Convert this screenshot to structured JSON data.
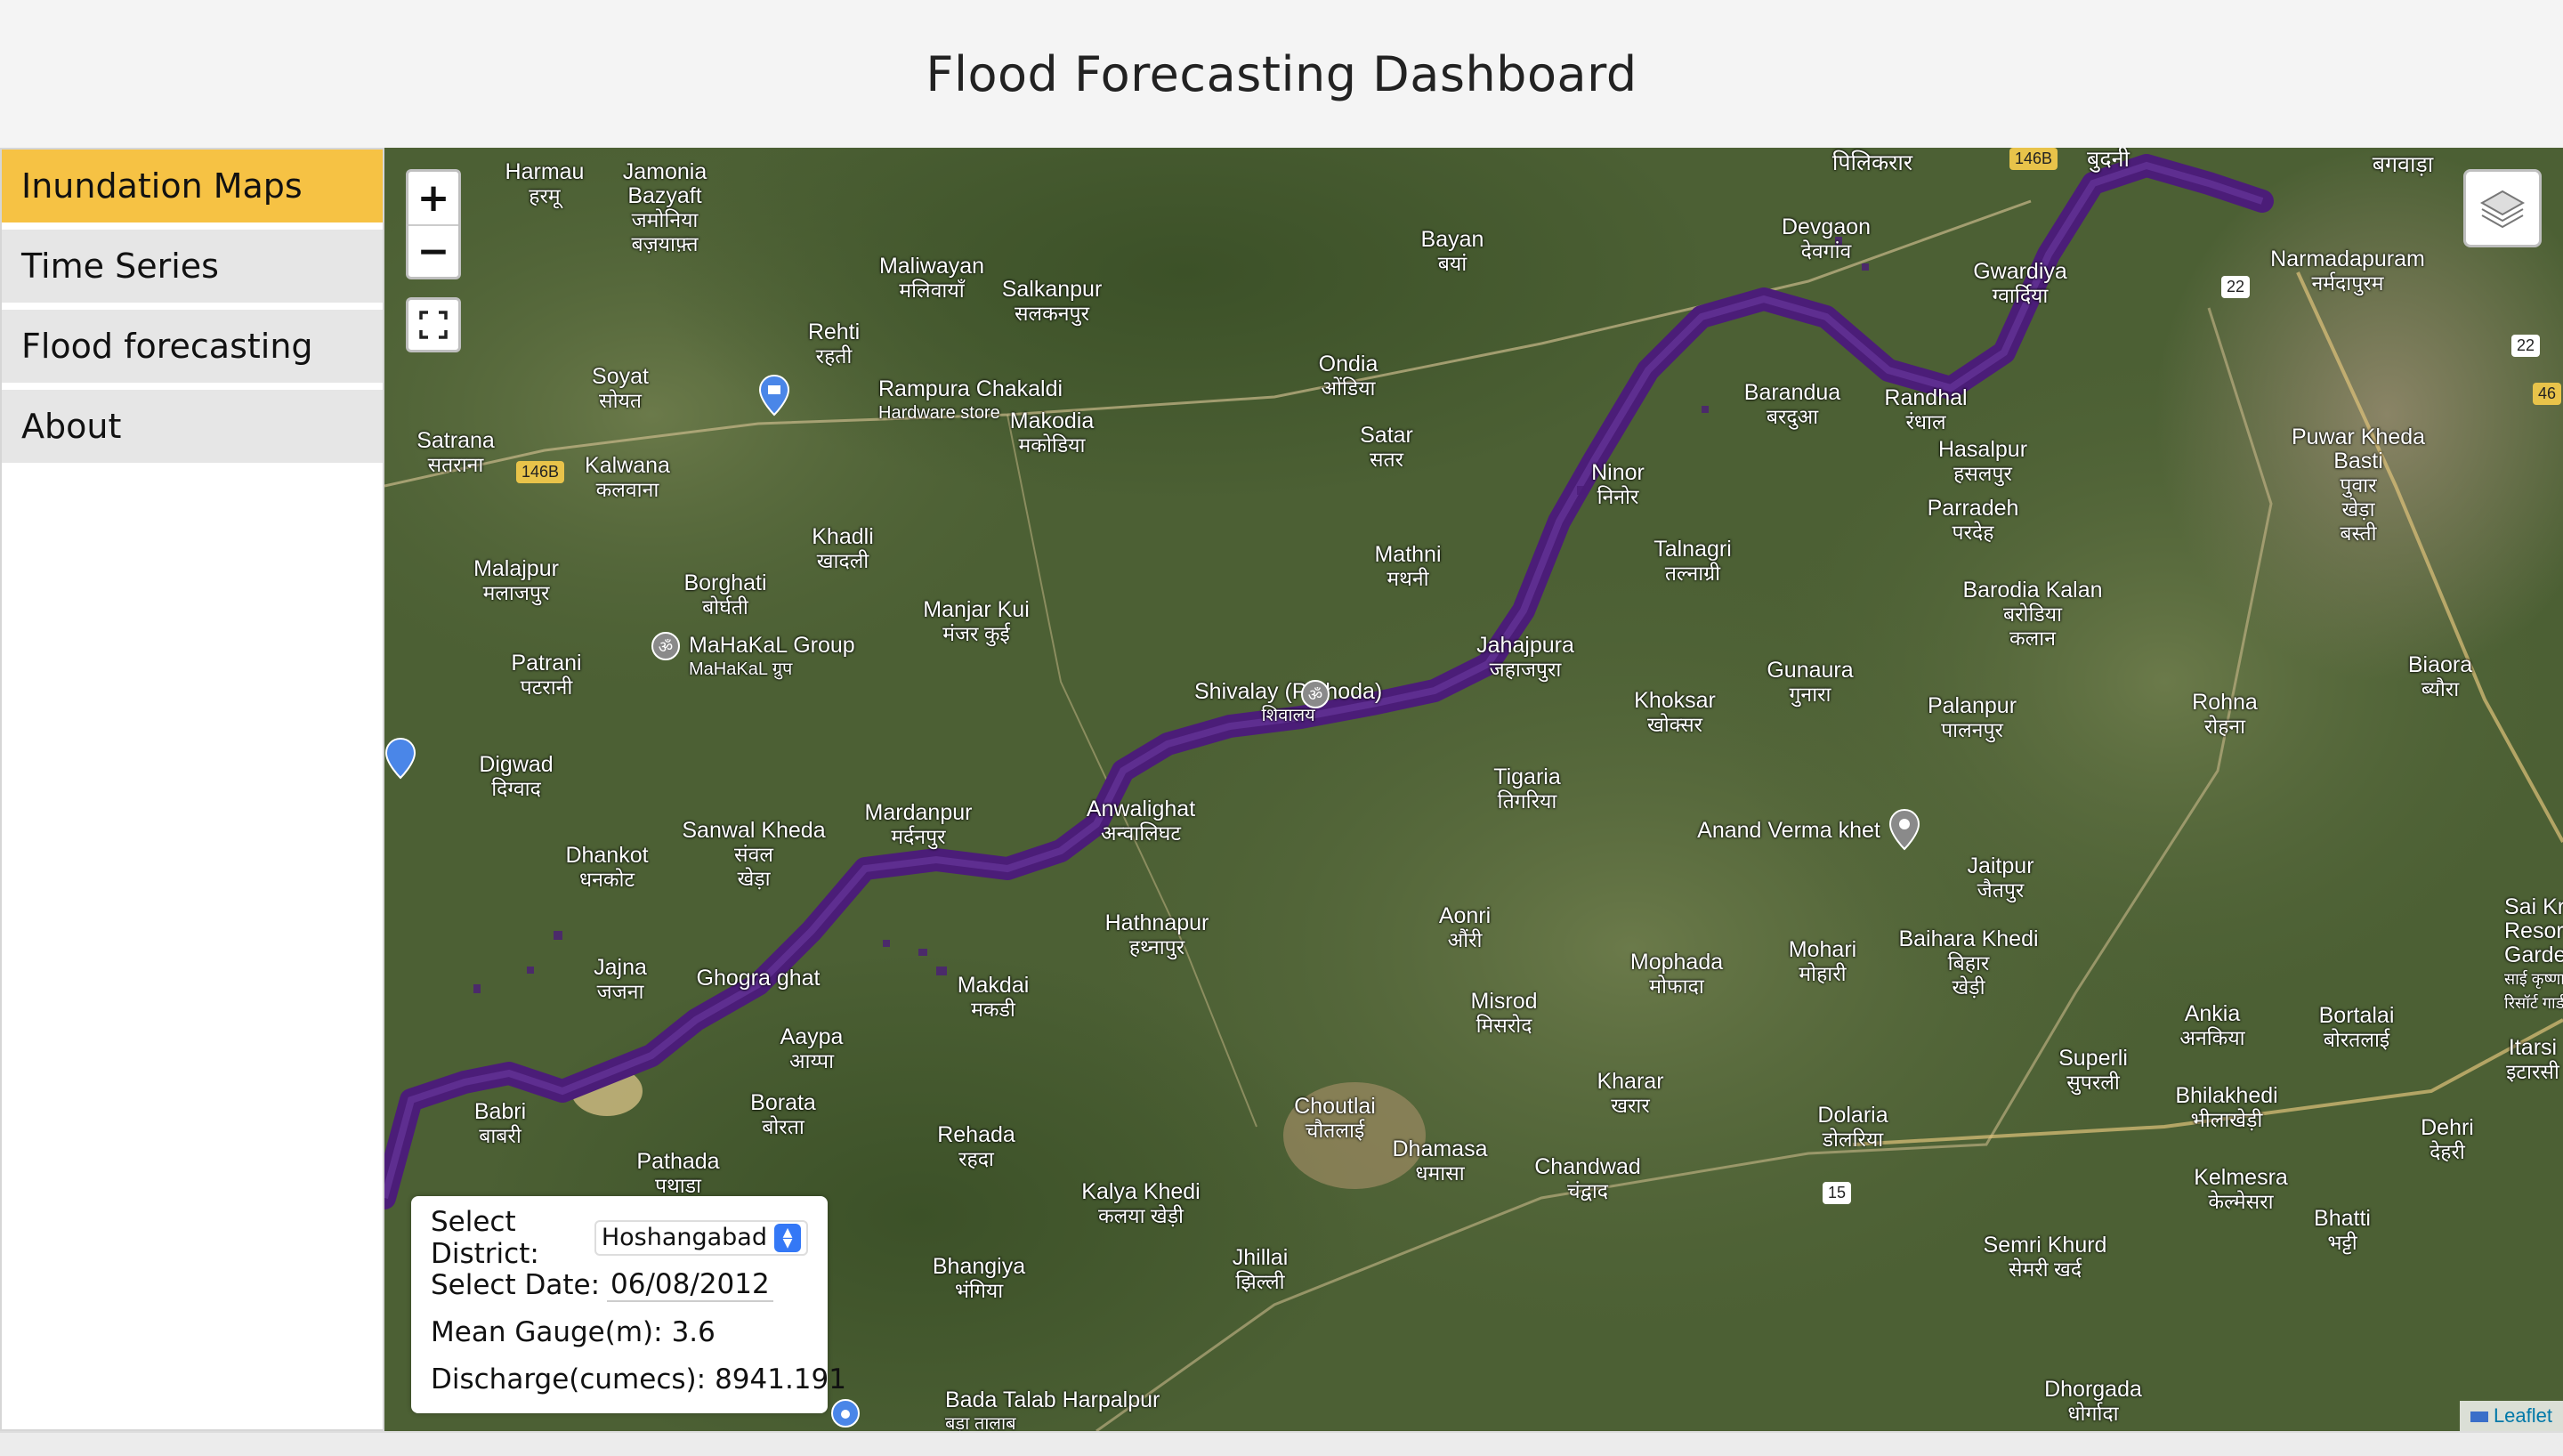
{
  "header": {
    "title": "Flood Forecasting Dashboard"
  },
  "sidebar": {
    "items": [
      {
        "label": "Inundation Maps",
        "active": true
      },
      {
        "label": "Time Series",
        "active": false
      },
      {
        "label": "Flood forecasting",
        "active": false
      },
      {
        "label": "About",
        "active": false
      }
    ]
  },
  "map": {
    "zoom_in": "+",
    "zoom_out": "−",
    "attribution": "Leaflet",
    "colors": {
      "flood": "#4b1d78",
      "land": "#4a5e33",
      "accent": "#f6c244"
    },
    "places": [
      {
        "name": "Harmau",
        "hindi": "हरमू"
      },
      {
        "name": "Jamonia Bazyaft",
        "hindi": "जमोनिया बज़याफ़्त"
      },
      {
        "name": "Maliwayan",
        "hindi": "मलिवायाँ"
      },
      {
        "name": "Salkanpur",
        "hindi": "सलकनपुर"
      },
      {
        "name": "Rehti",
        "hindi": "रहती"
      },
      {
        "name": "Soyat",
        "hindi": "सोयत"
      },
      {
        "name": "Rampura Chakaldi",
        "hindi": "Hardware store"
      },
      {
        "name": "Makodia",
        "hindi": "मकोडिया"
      },
      {
        "name": "Satrana",
        "hindi": "सतराना"
      },
      {
        "name": "Kalwana",
        "hindi": "कलवाना"
      },
      {
        "name": "Khadli",
        "hindi": "खादली"
      },
      {
        "name": "Malajpur",
        "hindi": "मलाजपुर"
      },
      {
        "name": "Borghati",
        "hindi": "बोर्घती"
      },
      {
        "name": "MaHaKaL Group",
        "hindi": "MaHaKaL ग्रुप"
      },
      {
        "name": "Manjar Kui",
        "hindi": "मंजर कुई"
      },
      {
        "name": "Patrani",
        "hindi": "पटरानी"
      },
      {
        "name": "Digwad",
        "hindi": "दिग्वाद"
      },
      {
        "name": "Dhankot",
        "hindi": "धनकोट"
      },
      {
        "name": "Sanwal Kheda",
        "hindi": "संवल खेड़ा"
      },
      {
        "name": "Mardanpur",
        "hindi": "मर्दनपुर"
      },
      {
        "name": "Anwalighat",
        "hindi": "अन्वालिघट"
      },
      {
        "name": "Jajna",
        "hindi": "जजना"
      },
      {
        "name": "Ghogra ghat",
        "hindi": ""
      },
      {
        "name": "Makdai",
        "hindi": "मकडी"
      },
      {
        "name": "Aaypa",
        "hindi": "आय्पा"
      },
      {
        "name": "Hathnapur",
        "hindi": "हथ्नापुर"
      },
      {
        "name": "Babri",
        "hindi": "बाबरी"
      },
      {
        "name": "Borata",
        "hindi": "बोरता"
      },
      {
        "name": "Pathada",
        "hindi": "पथाडा"
      },
      {
        "name": "Rehada",
        "hindi": "रहदा"
      },
      {
        "name": "Kalya Khedi",
        "hindi": "कलया खेड़ी"
      },
      {
        "name": "Bhangiya",
        "hindi": "भंगिया"
      },
      {
        "name": "Jhillai",
        "hindi": "झिल्ली"
      },
      {
        "name": "Choutlai",
        "hindi": "चौतलाई"
      },
      {
        "name": "Dhamasa",
        "hindi": "धमासा"
      },
      {
        "name": "Chandwad",
        "hindi": "चंद्वाद"
      },
      {
        "name": "Bada Talab Harpalpur",
        "hindi": "बड़ा तालाब"
      },
      {
        "name": "Shivalay (Pathoda)",
        "hindi": "शिवालय"
      },
      {
        "name": "Bayan",
        "hindi": "बयां"
      },
      {
        "name": "Ondia",
        "hindi": "ओंडिया"
      },
      {
        "name": "Satar",
        "hindi": "सतर"
      },
      {
        "name": "Mathni",
        "hindi": "मथनी"
      },
      {
        "name": "Jahajpura",
        "hindi": "जहाजपुरा"
      },
      {
        "name": "Tigaria",
        "hindi": "तिगरिया"
      },
      {
        "name": "Aonri",
        "hindi": "औंरी"
      },
      {
        "name": "Misrod",
        "hindi": "मिसरोद"
      },
      {
        "name": "Ninor",
        "hindi": "निनोर"
      },
      {
        "name": "Talnagri",
        "hindi": "तल्नाग्री"
      },
      {
        "name": "Khoksar",
        "hindi": "खोक्सर"
      },
      {
        "name": "Devgaon",
        "hindi": "देवगांव"
      },
      {
        "name": "Barandua",
        "hindi": "बरदुआ"
      },
      {
        "name": "Gwardiya",
        "hindi": "ग्वार्दिया"
      },
      {
        "name": "Randhal",
        "hindi": "रंधाल"
      },
      {
        "name": "Hasalpur",
        "hindi": "हसलपुर"
      },
      {
        "name": "Parradeh",
        "hindi": "परदेह"
      },
      {
        "name": "Gunaura",
        "hindi": "गुनारा"
      },
      {
        "name": "Barodia Kalan",
        "hindi": "बरोडिया कलान"
      },
      {
        "name": "Palanpur",
        "hindi": "पालनपुर"
      },
      {
        "name": "Anand Verma khet",
        "hindi": ""
      },
      {
        "name": "Jaitpur",
        "hindi": "जैतपुर"
      },
      {
        "name": "Baihara Khedi",
        "hindi": "बिहार खेड़ी"
      },
      {
        "name": "Mophada",
        "hindi": "मोफादा"
      },
      {
        "name": "Mohari",
        "hindi": "मोहारी"
      },
      {
        "name": "Kharar",
        "hindi": "खरार"
      },
      {
        "name": "Dolaria",
        "hindi": "डोलरिया"
      },
      {
        "name": "Superli",
        "hindi": "सुपरली"
      },
      {
        "name": "Ankia",
        "hindi": "अनकिया"
      },
      {
        "name": "Bhilakhedi",
        "hindi": "भीलाखेड़ी"
      },
      {
        "name": "Bortalai",
        "hindi": "बोरतलाई"
      },
      {
        "name": "Kelmesra",
        "hindi": "केल्मेसरा"
      },
      {
        "name": "Bhatti",
        "hindi": "भट्टी"
      },
      {
        "name": "Semri Khurd",
        "hindi": "सेमरी खर्द"
      },
      {
        "name": "Dhorgada",
        "hindi": "धोर्गादा"
      },
      {
        "name": "Narmadapuram",
        "hindi": "नर्मदापुरम"
      },
      {
        "name": "Puwar Kheda Basti",
        "hindi": "पुवार खेड़ा बस्ती"
      },
      {
        "name": "Rohna",
        "hindi": "रोहना"
      },
      {
        "name": "Biaora",
        "hindi": "ब्यौरा"
      },
      {
        "name": "Dehri",
        "hindi": "देहरी"
      },
      {
        "name": "Itarsi",
        "hindi": "इटारसी"
      },
      {
        "name": "Sai Krishna Resort Garden",
        "hindi": "साई कृष्णा रिसॉर्ट गार्डन"
      },
      {
        "name": "पिलिकरार",
        "hindi": ""
      },
      {
        "name": "बुदनी",
        "hindi": ""
      },
      {
        "name": "बगवाड़ा",
        "hindi": ""
      }
    ],
    "road_labels": [
      "146B",
      "146B",
      "22",
      "22",
      "46",
      "15"
    ]
  },
  "info_panel": {
    "district_label": "Select District:",
    "district_value": "Hoshangabad",
    "date_label": "Select Date:",
    "date_value": "06/08/2012",
    "gauge_label": "Mean Gauge(m):",
    "gauge_value": "3.6",
    "discharge_label": "Discharge(cumecs):",
    "discharge_value": "8941.191"
  }
}
